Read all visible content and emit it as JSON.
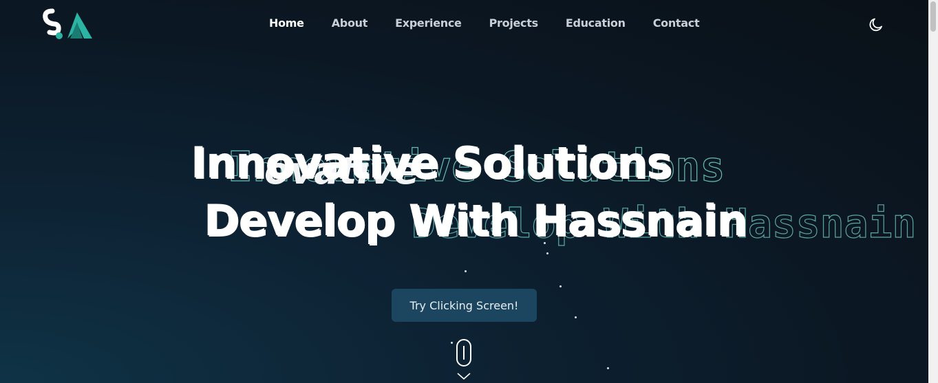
{
  "logo": {
    "text": "SA"
  },
  "nav": {
    "links": [
      {
        "label": "Home",
        "active": true
      },
      {
        "label": "About",
        "active": false
      },
      {
        "label": "Experience",
        "active": false
      },
      {
        "label": "Projects",
        "active": false
      },
      {
        "label": "Education",
        "active": false
      },
      {
        "label": "Contact",
        "active": false
      }
    ],
    "theme_icon": "moon-icon"
  },
  "hero": {
    "line1": "Innovative Solutions",
    "line1_overlay": "ovative",
    "line2": "Develop With Hassnain",
    "cta_label": "Try Clicking Screen!"
  },
  "colors": {
    "accent": "#2bb3a3",
    "button_bg": "#1c4660",
    "background": "#0b1824"
  }
}
